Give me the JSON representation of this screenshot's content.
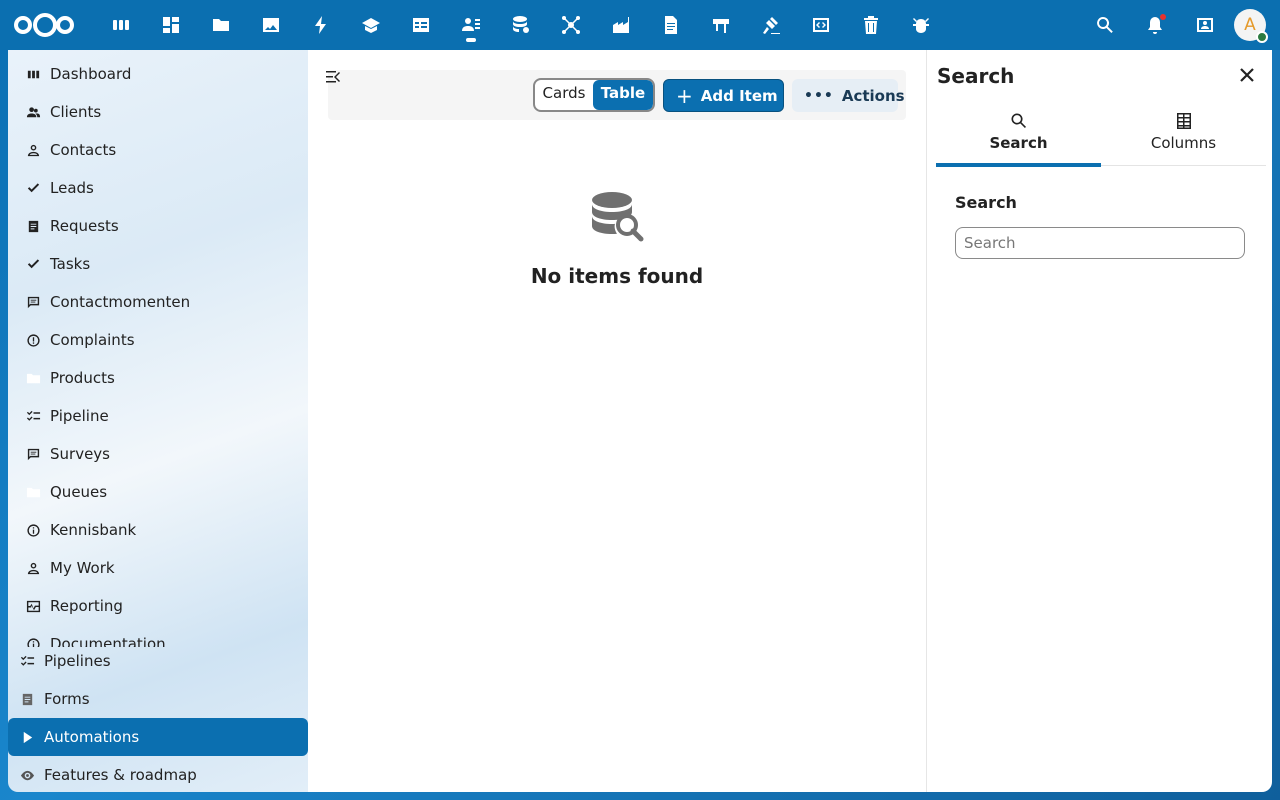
{
  "topbar": {
    "apps": [
      {
        "icon": "dashboard-icon"
      },
      {
        "icon": "grid-icon"
      },
      {
        "icon": "files-icon"
      },
      {
        "icon": "photos-icon"
      },
      {
        "icon": "activity-icon"
      },
      {
        "icon": "learning-icon"
      },
      {
        "icon": "calendar-table-icon"
      },
      {
        "icon": "contacts-list-icon",
        "active": true
      },
      {
        "icon": "database-settings-icon"
      },
      {
        "icon": "network-icon"
      },
      {
        "icon": "factory-icon"
      },
      {
        "icon": "document-icon"
      },
      {
        "icon": "flag-icon"
      },
      {
        "icon": "gavel-icon"
      },
      {
        "icon": "code-icon"
      },
      {
        "icon": "trash-icon"
      },
      {
        "icon": "bug-icon"
      }
    ],
    "avatar_initial": "A"
  },
  "sidebar": {
    "items": [
      {
        "label": "Dashboard",
        "icon": "chart-bar-icon"
      },
      {
        "label": "Clients",
        "icon": "users-icon"
      },
      {
        "label": "Contacts",
        "icon": "user-icon"
      },
      {
        "label": "Leads",
        "icon": "check-icon"
      },
      {
        "label": "Requests",
        "icon": "document-icon"
      },
      {
        "label": "Tasks",
        "icon": "check-icon"
      },
      {
        "label": "Contactmomenten",
        "icon": "message-icon"
      },
      {
        "label": "Complaints",
        "icon": "alert-icon"
      },
      {
        "label": "Products",
        "icon": "folder-icon"
      },
      {
        "label": "Pipeline",
        "icon": "checklist-icon"
      },
      {
        "label": "Surveys",
        "icon": "message-icon"
      },
      {
        "label": "Queues",
        "icon": "folder-icon"
      },
      {
        "label": "Kennisbank",
        "icon": "info-icon"
      },
      {
        "label": "My Work",
        "icon": "user-icon"
      },
      {
        "label": "Reporting",
        "icon": "pulse-icon"
      },
      {
        "label": "Documentation",
        "icon": "info-icon"
      }
    ],
    "bottom_items": [
      {
        "label": "Pipelines",
        "icon": "checklist-icon"
      },
      {
        "label": "Forms",
        "icon": "document-icon"
      },
      {
        "label": "Automations",
        "icon": "play-icon",
        "active": true
      },
      {
        "label": "Features & roadmap",
        "icon": "eye-icon"
      }
    ]
  },
  "main": {
    "view_cards": "Cards",
    "view_table": "Table",
    "add_label": "Add Item",
    "actions_label": "Actions",
    "empty_title": "No items found"
  },
  "panel": {
    "title": "Search",
    "tabs": [
      {
        "label": "Search",
        "icon": "search-icon",
        "active": true
      },
      {
        "label": "Columns",
        "icon": "columns-icon"
      }
    ],
    "search_label": "Search",
    "search_placeholder": "Search",
    "search_value": ""
  },
  "colors": {
    "primary": "#0b6fb0",
    "topbar": "#0b6fb0",
    "text": "#222222"
  }
}
